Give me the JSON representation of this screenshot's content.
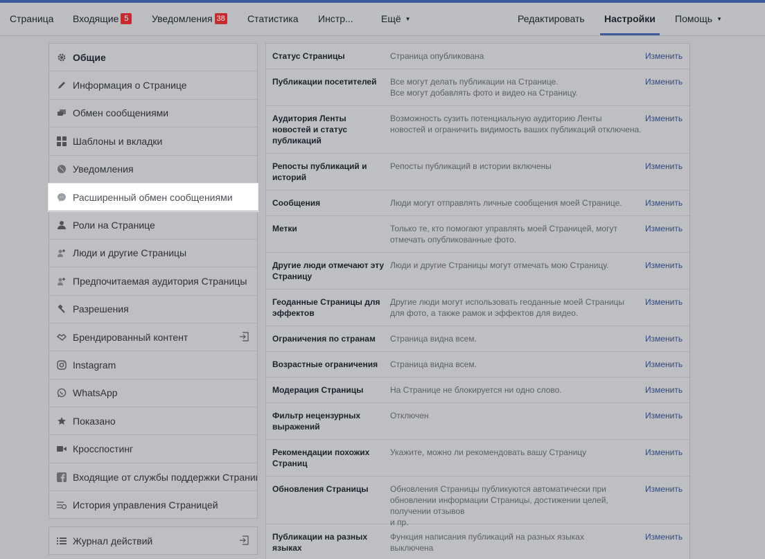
{
  "nav": {
    "page": "Страница",
    "inbox": "Входящие",
    "inbox_badge": "5",
    "notifications": "Уведомления",
    "notifications_badge": "38",
    "stats": "Статистика",
    "tools": "Инстр...",
    "more": "Ещё",
    "edit": "Редактировать",
    "settings": "Настройки",
    "help": "Помощь"
  },
  "sidebar": {
    "items": [
      {
        "label": "Общие",
        "icon": "gear-icon"
      },
      {
        "label": "Информация о Странице",
        "icon": "pencil-icon"
      },
      {
        "label": "Обмен сообщениями",
        "icon": "chat-icon"
      },
      {
        "label": "Шаблоны и вкладки",
        "icon": "grid-icon"
      },
      {
        "label": "Уведомления",
        "icon": "globe-icon"
      },
      {
        "label": "Расширенный обмен сообщениями",
        "icon": "messenger-icon"
      },
      {
        "label": "Роли на Странице",
        "icon": "person-icon"
      },
      {
        "label": "Люди и другие Страницы",
        "icon": "people-icon"
      },
      {
        "label": "Предпочитаемая аудитория Страницы",
        "icon": "audience-icon"
      },
      {
        "label": "Разрешения",
        "icon": "wrench-icon"
      },
      {
        "label": "Брендированный контент",
        "icon": "handshake-icon"
      },
      {
        "label": "Instagram",
        "icon": "instagram-icon"
      },
      {
        "label": "WhatsApp",
        "icon": "whatsapp-icon"
      },
      {
        "label": "Показано",
        "icon": "star-icon"
      },
      {
        "label": "Кросспостинг",
        "icon": "video-icon"
      },
      {
        "label": "Входящие от службы поддержки Страниц",
        "icon": "facebook-icon"
      },
      {
        "label": "История управления Страницей",
        "icon": "history-icon"
      }
    ],
    "activity_log": "Журнал действий"
  },
  "settings": {
    "edit_label": "Изменить",
    "rows": [
      {
        "label": "Статус Страницы",
        "value": "Страница опубликована"
      },
      {
        "label": "Публикации посетителей",
        "value": "Все могут делать публикации на Странице.\nВсе могут добавлять фото и видео на Страницу."
      },
      {
        "label": "Аудитория Ленты новостей и статус публикаций",
        "value": "Возможность сузить потенциальную аудиторию Ленты\nновостей и ограничить видимость ваших публикаций отключена."
      },
      {
        "label": "Репосты публикаций и историй",
        "value": "Репосты публикаций в истории включены"
      },
      {
        "label": "Сообщения",
        "value": "Люди могут отправлять личные сообщения моей Странице."
      },
      {
        "label": "Метки",
        "value": "Только те, кто помогают управлять моей Страницей, могут\nотмечать опубликованные фото."
      },
      {
        "label": "Другие люди отмечают эту Страницу",
        "value": "Люди и другие Страницы могут отмечать мою Страницу."
      },
      {
        "label": "Геоданные Страницы для эффектов",
        "value": "Другие люди могут использовать геоданные моей Страницы\nдля фото, а также рамок и эффектов для видео."
      },
      {
        "label": "Ограничения по странам",
        "value": "Страница видна всем."
      },
      {
        "label": "Возрастные ограничения",
        "value": "Страница видна всем."
      },
      {
        "label": "Модерация Страницы",
        "value": "На Странице не блокируется ни одно слово."
      },
      {
        "label": "Фильтр нецензурных выражений",
        "value": "Отключен"
      },
      {
        "label": "Рекомендации похожих Страниц",
        "value": "Укажите, можно ли рекомендовать вашу Страницу"
      },
      {
        "label": "Обновления Страницы",
        "value": "Обновления Страницы публикуются автоматически при\nобновлении информации Страницы, достижении целей, получении отзывов\nи пр."
      },
      {
        "label": "Публикации на разных языках",
        "value": "Функция написания публикаций на разных языках\nвыключена"
      }
    ]
  }
}
